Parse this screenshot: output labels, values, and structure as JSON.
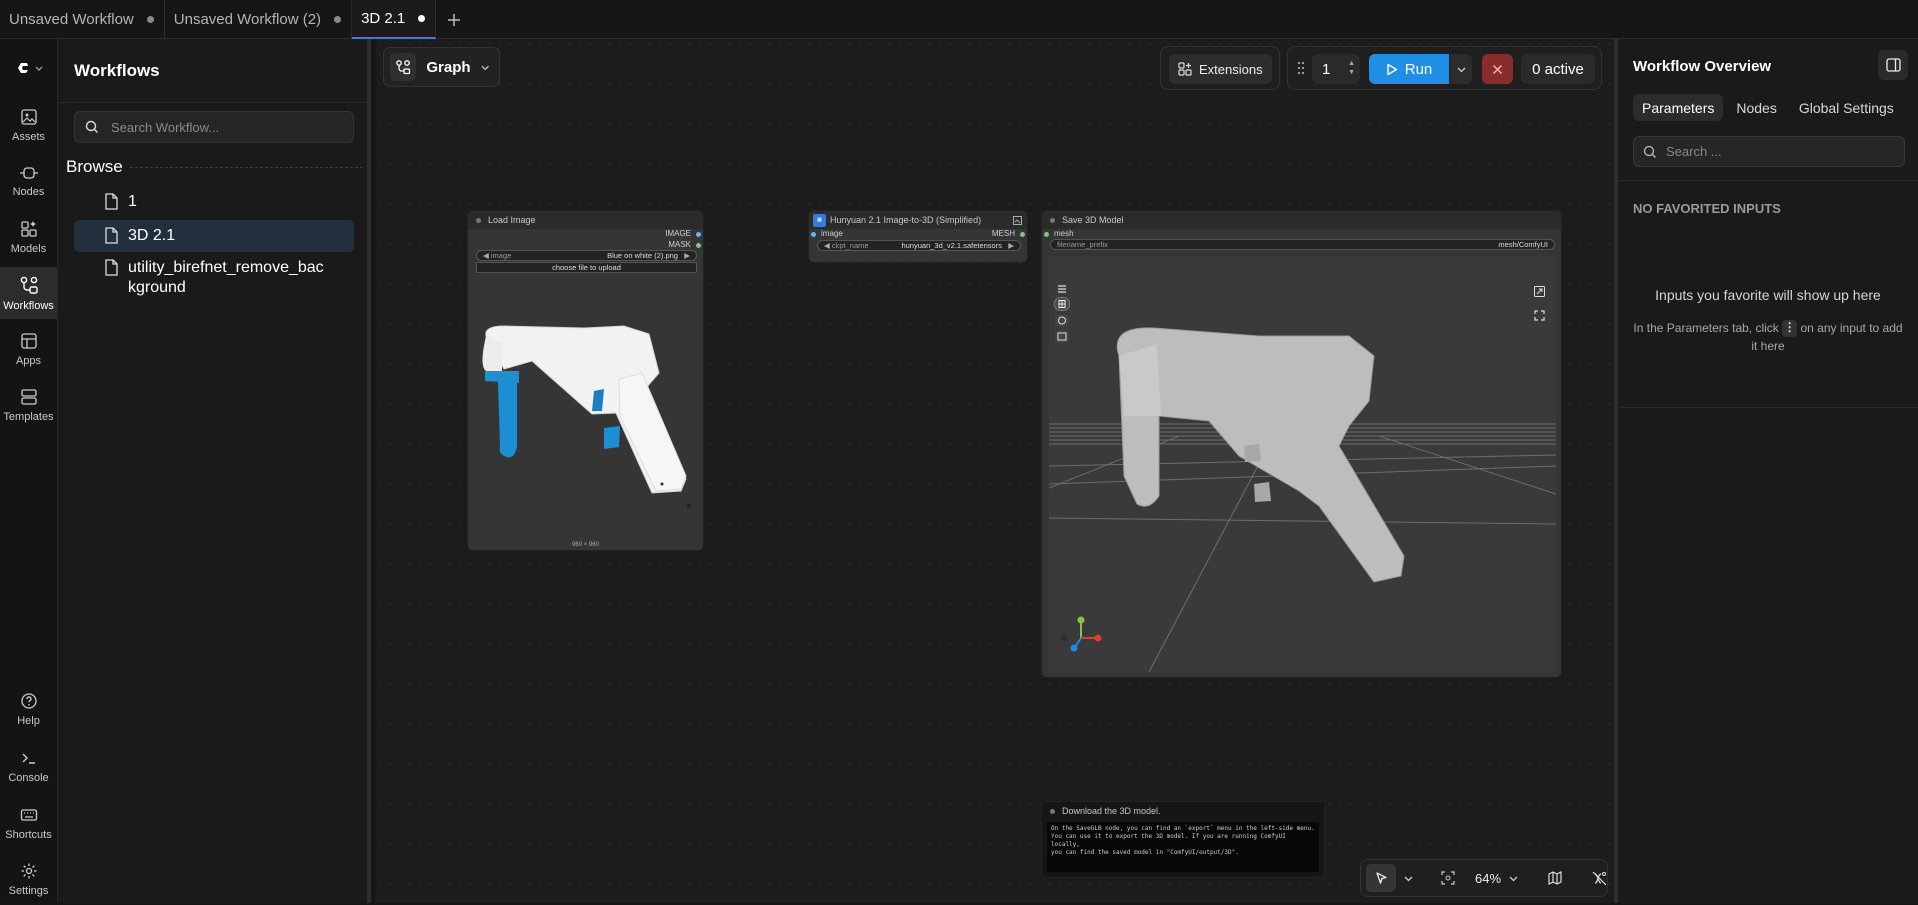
{
  "tabs": [
    {
      "label": "Unsaved Workflow",
      "active": false
    },
    {
      "label": "Unsaved Workflow (2)",
      "active": false
    },
    {
      "label": "3D 2.1",
      "active": true
    }
  ],
  "rail": {
    "items": [
      {
        "label": "Assets",
        "icon": "image-icon"
      },
      {
        "label": "Nodes",
        "icon": "node-icon"
      },
      {
        "label": "Models",
        "icon": "models-icon"
      },
      {
        "label": "Workflows",
        "icon": "workflow-icon"
      },
      {
        "label": "Apps",
        "icon": "apps-icon"
      },
      {
        "label": "Templates",
        "icon": "templates-icon"
      }
    ],
    "bottom_items": [
      {
        "label": "Help",
        "icon": "help-icon"
      },
      {
        "label": "Console",
        "icon": "terminal-icon"
      },
      {
        "label": "Shortcuts",
        "icon": "keyboard-icon"
      },
      {
        "label": "Settings",
        "icon": "gear-icon"
      }
    ]
  },
  "workflows_panel": {
    "title": "Workflows",
    "search_placeholder": "Search Workflow...",
    "browse_label": "Browse",
    "items": [
      {
        "label": "1",
        "active": false
      },
      {
        "label": "3D 2.1",
        "active": true
      },
      {
        "label": "utility_birefnet_remove_background",
        "active": false
      }
    ]
  },
  "toolbar": {
    "graph_label": "Graph",
    "extensions_label": "Extensions",
    "run_count": "1",
    "run_label": "Run",
    "active_label": "0 active"
  },
  "nodes": {
    "load_image": {
      "title": "Load Image",
      "out_image": "IMAGE",
      "out_mask": "MASK",
      "widget_label": "image",
      "widget_value": "Blue on white (2).png",
      "upload_label": "choose file to upload",
      "size_label": "960 × 960"
    },
    "hunyuan": {
      "title": "Hunyuan 2.1 Image-to-3D (Simplified)",
      "in_image": "image",
      "out_mesh": "MESH",
      "widget_label": "ckpt_name",
      "widget_value": "hunyuan_3d_v2.1.safetensors"
    },
    "save3d": {
      "title": "Save 3D Model",
      "in_mesh": "mesh",
      "widget_label": "filename_prefix",
      "widget_value": "mesh/ComfyUI"
    },
    "note": {
      "title": "Download the 3D model.",
      "text": "On the SaveGLB node, you can find an `export` menu in the left-side menu.\nYou can use it to export the 3D model. If you are running ComfyUI locally,\nyou can find the saved model in \"ComfyUI/output/3D\"."
    }
  },
  "canvas_tools": {
    "zoom": "64%"
  },
  "right_panel": {
    "title": "Workflow Overview",
    "tabs": [
      "Parameters",
      "Nodes",
      "Global Settings"
    ],
    "active_tab": "Parameters",
    "search_placeholder": "Search ...",
    "no_favorites": "NO FAVORITED INPUTS",
    "empty_title": "Inputs you favorite will show up here",
    "empty_hint_before": "In the Parameters tab, click",
    "empty_hint_after": "on any input to add it here"
  },
  "colors": {
    "accent": "#1f8fe6",
    "active_tab_underline": "#3f7fd6",
    "stop_button": "#8a2c2c",
    "image_slot": "#64b5f6",
    "mask_slot": "#81c784",
    "mesh_slot": "#81c784"
  }
}
